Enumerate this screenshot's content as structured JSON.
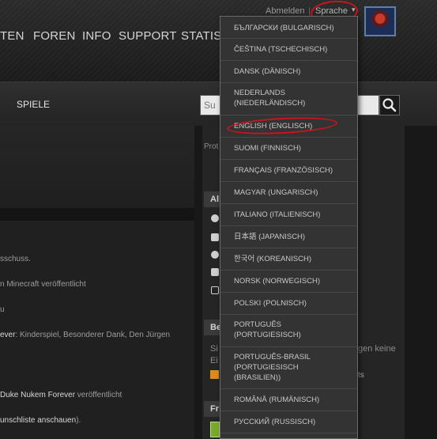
{
  "header": {
    "logout_label": "Abmelden",
    "separator": "|",
    "language_label": "Sprache",
    "caret": "▾",
    "nav": [
      "TEN",
      "FOREN",
      "INFO",
      "SUPPORT",
      "STATIS"
    ]
  },
  "subnav": {
    "games_label": "SPIELE",
    "search_placeholder": "Su"
  },
  "language_menu": {
    "options": [
      "БЪЛГАРСКИ (BULGARISCH)",
      "ČEŠTINA (TSCHECHISCH)",
      "DANSK (DÄNISCH)",
      "NEDERLANDS (NIEDERLÄNDISCH)",
      "ENGLISH (ENGLISCH)",
      "SUOMI (FINNISCH)",
      "FRANÇAIS (FRANZÖSISCH)",
      "MAGYAR (UNGARISCH)",
      "ITALIANO (ITALIENISCH)",
      "日本語 (JAPANISCH)",
      "한국어 (KOREANISCH)",
      "NORSK (NORWEGISCH)",
      "POLSKI (POLNISCH)",
      "PORTUGUÊS (PORTUGIESISCH)",
      "PORTUGUÊS-BRASIL (PORTUGIESISCH (BRASILIEN))",
      "ROMÂNĂ (RUMÄNISCH)",
      "РУССКИЙ (RUSSISCH)"
    ]
  },
  "feed": {
    "line1": "sschuss.",
    "line2": "n Minecraft veröffentlicht",
    "line3": "u",
    "line4_bold": "ever",
    "line4_rest": ": Kinderspiel, Besonderer Dank, Den Jürgen",
    "line5_bold": "Duke Nukem Forever",
    "line5_rest": " veröffentlicht",
    "line6_bold": "unschliste anschauen",
    "line6_rest": ")."
  },
  "right": {
    "prot": "Prot",
    "box1_head": "Al",
    "box2_head": "Be",
    "box2_line1_a": "Si",
    "box2_line1_b": "gen keine",
    "box2_line2": "Ei",
    "box2_line3": "ts",
    "box3_head": "Fr"
  },
  "colors": {
    "annotation": "#c8141e",
    "avatar_border": "#5f7fa6"
  }
}
